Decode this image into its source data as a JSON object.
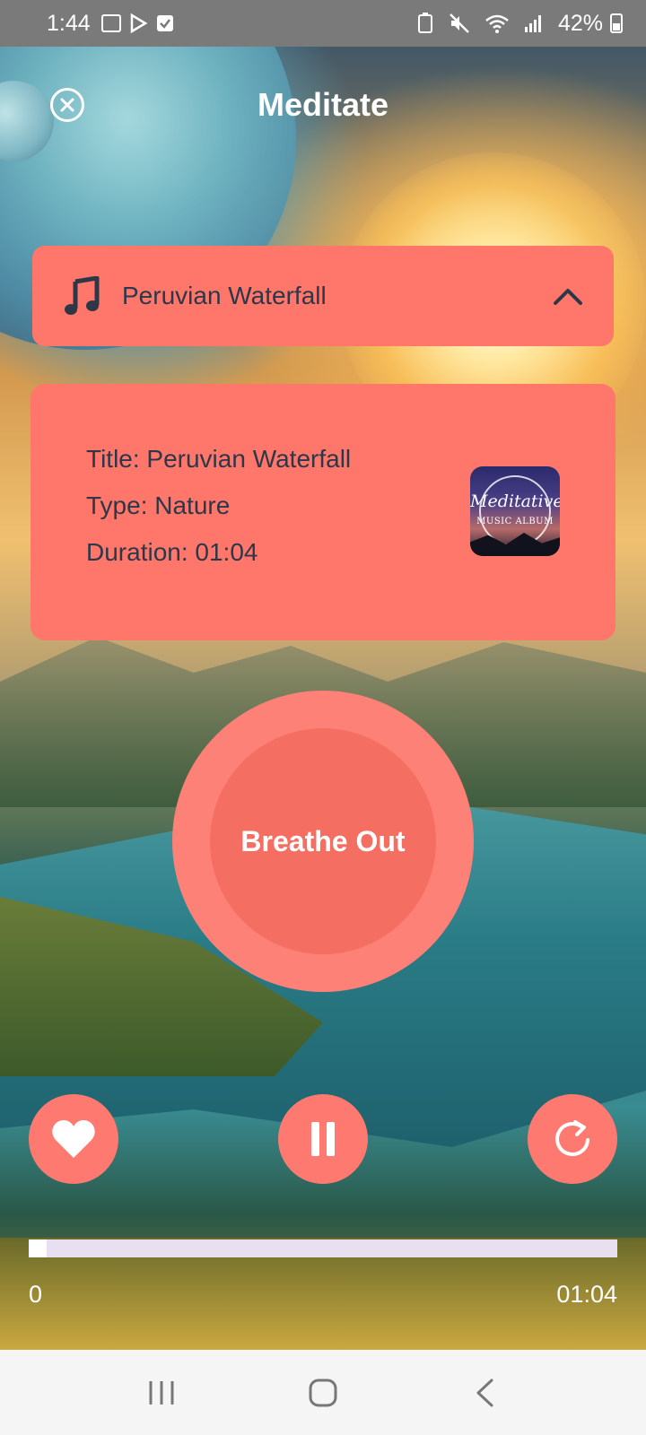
{
  "status_bar": {
    "time": "1:44",
    "battery": "42%"
  },
  "header": {
    "title": "Meditate"
  },
  "track_selector": {
    "name": "Peruvian Waterfall"
  },
  "info_card": {
    "title_line": "Title: Peruvian Waterfall",
    "type_line": "Type: Nature",
    "duration_line": "Duration: 01:04",
    "album_art_text": "Meditative",
    "album_art_subtext": "MUSIC ALBUM"
  },
  "breath": {
    "label": "Breathe Out"
  },
  "controls": {
    "favorite": "heart-icon",
    "pause": "pause-icon",
    "replay": "replay-icon"
  },
  "progress": {
    "fraction": 0.03,
    "start_label": "0",
    "end_label": "01:04"
  },
  "colors": {
    "accent": "#ff766b",
    "breath_outer": "#fe8177",
    "breath_inner": "#f56e62",
    "text_dark": "#2d3748",
    "progress_track": "#e8e0f0"
  }
}
